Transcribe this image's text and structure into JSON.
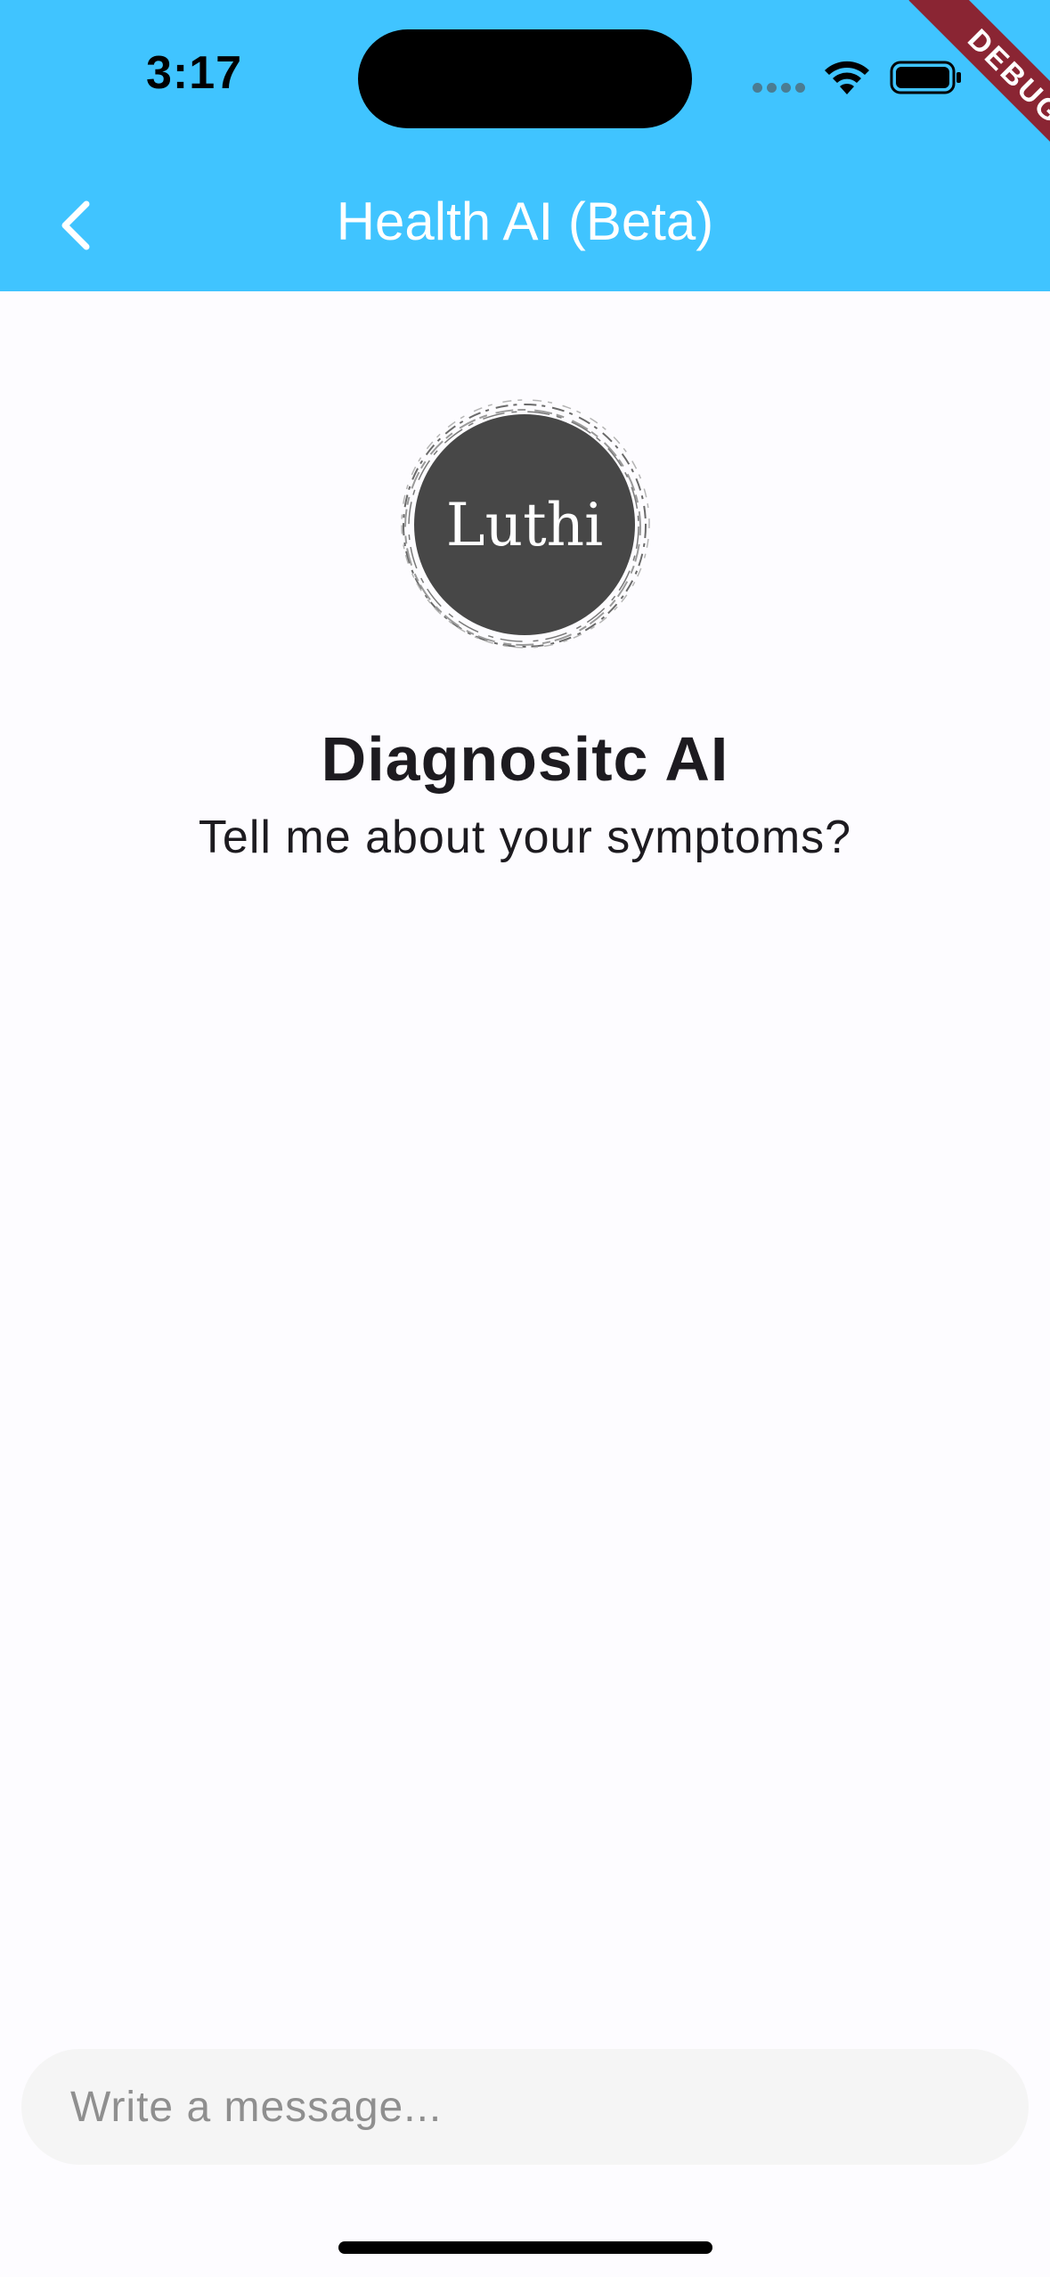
{
  "status_bar": {
    "time": "3:17",
    "icons": [
      "signal-dots-icon",
      "wifi-icon",
      "battery-icon"
    ]
  },
  "debug_banner": {
    "label": "DEBUG",
    "color": "#8a2533"
  },
  "app_bar": {
    "title": "Health AI (Beta)",
    "back_icon": "chevron-left-icon",
    "background_color": "#40c4ff"
  },
  "avatar": {
    "label": "Luthi"
  },
  "intro": {
    "title": "Diagnositc AI",
    "subtitle": "Tell me about your symptoms?"
  },
  "composer": {
    "placeholder": "Write a message...",
    "value": ""
  }
}
